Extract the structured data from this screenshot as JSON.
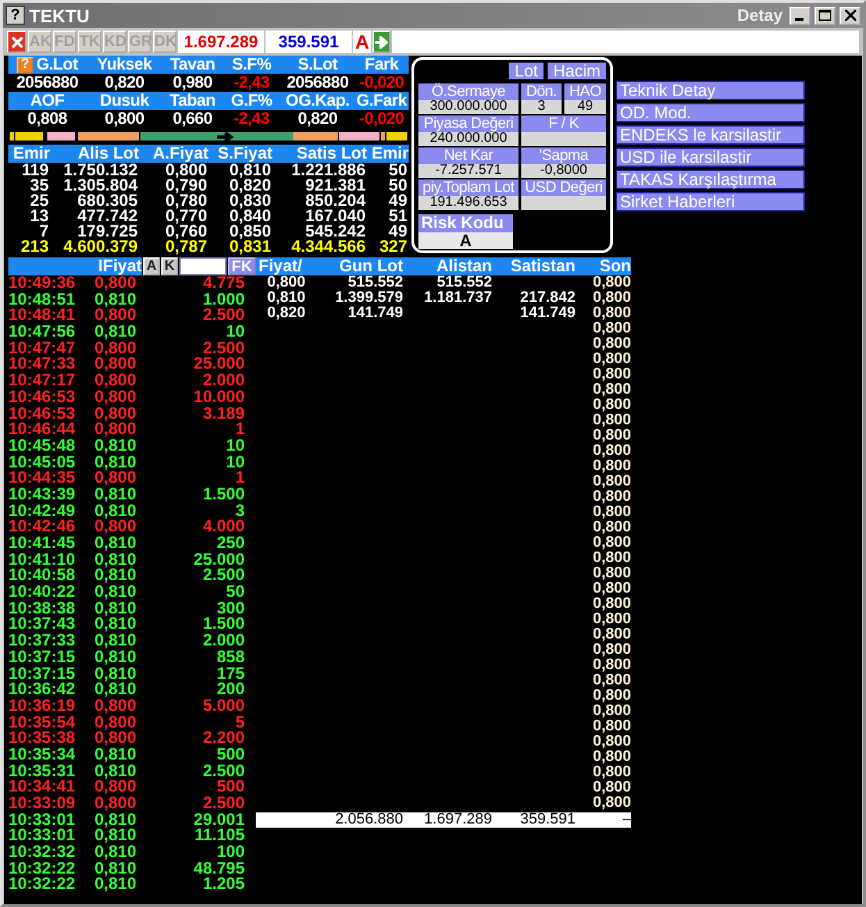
{
  "window": {
    "title_icon": "?",
    "title": "TEKTU",
    "subtitle": "Detay"
  },
  "toolbar": {
    "tabs": [
      {
        "label": "AK",
        "disabled": true
      },
      {
        "label": "FD",
        "disabled": true
      },
      {
        "label": "TK",
        "disabled": true
      },
      {
        "label": "KD",
        "disabled": true
      },
      {
        "label": "GR",
        "disabled": true
      },
      {
        "label": "DK",
        "disabled": true
      }
    ],
    "buy_total": "1.697.289",
    "sell_total": "359.591",
    "risk_flag": "A"
  },
  "stats": {
    "help": "?",
    "rows": [
      {
        "cells": [
          {
            "label": "G.Lot",
            "value": "2056880",
            "negative": false
          },
          {
            "label": "Yuksek",
            "value": "0,820",
            "negative": false
          },
          {
            "label": "Tavan",
            "value": "0,980",
            "negative": false
          },
          {
            "label": "S.F%",
            "value": "-2,43",
            "negative": true
          },
          {
            "label": "S.Lot",
            "value": "2056880",
            "negative": false
          },
          {
            "label": "Fark",
            "value": "-0,020",
            "negative": true
          }
        ]
      },
      {
        "cells": [
          {
            "label": "AOF",
            "value": "0,808",
            "negative": false
          },
          {
            "label": "Dusuk",
            "value": "0,800",
            "negative": false
          },
          {
            "label": "Taban",
            "value": "0,660",
            "negative": false
          },
          {
            "label": "G.F%",
            "value": "-2,43",
            "negative": true
          },
          {
            "label": "OG.Kap.",
            "value": "0,820",
            "negative": false
          },
          {
            "label": "G.Fark",
            "value": "-0,020",
            "negative": true
          }
        ]
      }
    ]
  },
  "order_book": {
    "columns": [
      "Emir",
      "Alis Lot",
      "A.Fiyat",
      "S.Fiyat",
      "Satis Lot",
      "Emir"
    ],
    "rows": [
      {
        "kind": "level",
        "cells": [
          "119",
          "1.750.132",
          "0,800",
          "0,810",
          "1.221.886",
          "50"
        ]
      },
      {
        "kind": "level",
        "cells": [
          "35",
          "1.305.804",
          "0,790",
          "0,820",
          "921.381",
          "50"
        ]
      },
      {
        "kind": "level",
        "cells": [
          "25",
          "680.305",
          "0,780",
          "0,830",
          "850.204",
          "49"
        ]
      },
      {
        "kind": "level",
        "cells": [
          "13",
          "477.742",
          "0,770",
          "0,840",
          "167.040",
          "51"
        ]
      },
      {
        "kind": "level",
        "cells": [
          "7",
          "179.725",
          "0,760",
          "0,850",
          "545.242",
          "49"
        ]
      },
      {
        "kind": "total",
        "cells": [
          "213",
          "4.600.379",
          "0,787",
          "0,831",
          "4.344.566",
          "327"
        ]
      }
    ]
  },
  "info_panel": {
    "toggles": [
      "Lot",
      "Hacim"
    ],
    "rows": [
      {
        "fields": [
          {
            "label": "Ö.Sermaye",
            "value": "300.000.000"
          },
          {
            "label": "Dön.",
            "value": "3"
          },
          {
            "label": "HAO",
            "value": "49"
          }
        ]
      },
      {
        "fields": [
          {
            "label": "Piyasa Değeri",
            "value": "240.000.000"
          },
          {
            "label": "F / K"
          }
        ]
      },
      {
        "fields": [
          {
            "label": "Net Kar",
            "value": "-7.257.571"
          },
          {
            "label": "'Sapma",
            "value": "-0,8000"
          }
        ]
      },
      {
        "fields": [
          {
            "label": "piy.Toplam Lot",
            "value": "191.496.653"
          },
          {
            "label": "USD Değeri"
          }
        ]
      }
    ],
    "risk": {
      "label": "Risk Kodu",
      "value": "A"
    }
  },
  "menu": [
    "Teknik Detay",
    "OD. Mod.",
    "ENDEKS le karsilastir",
    "USD ile karsilastir",
    "TAKAS Karşılaştırma",
    "Sirket Haberleri"
  ],
  "trades": {
    "header": "IFiyat",
    "buttons": [
      "A",
      "K"
    ],
    "filter": "FK",
    "rows": [
      {
        "time": "10:49:36",
        "price": "0,800",
        "lot": "4.775",
        "color": "#ff2020"
      },
      {
        "time": "10:48:51",
        "price": "0,810",
        "lot": "1.000",
        "color": "#33ff33"
      },
      {
        "time": "10:48:41",
        "price": "0,800",
        "lot": "2.500",
        "color": "#ff2020"
      },
      {
        "time": "10:47:56",
        "price": "0,810",
        "lot": "10",
        "color": "#33ff33"
      },
      {
        "time": "10:47:47",
        "price": "0,800",
        "lot": "2.500",
        "color": "#ff2020"
      },
      {
        "time": "10:47:33",
        "price": "0,800",
        "lot": "25.000",
        "color": "#ff2020"
      },
      {
        "time": "10:47:17",
        "price": "0,800",
        "lot": "2.000",
        "color": "#ff2020"
      },
      {
        "time": "10:46:53",
        "price": "0,800",
        "lot": "10.000",
        "color": "#ff2020"
      },
      {
        "time": "10:46:53",
        "price": "0,800",
        "lot": "3.189",
        "color": "#ff2020"
      },
      {
        "time": "10:46:44",
        "price": "0,800",
        "lot": "1",
        "color": "#ff2020"
      },
      {
        "time": "10:45:48",
        "price": "0,810",
        "lot": "10",
        "color": "#33ff33"
      },
      {
        "time": "10:45:05",
        "price": "0,810",
        "lot": "10",
        "color": "#33ff33"
      },
      {
        "time": "10:44:35",
        "price": "0,800",
        "lot": "1",
        "color": "#ff2020"
      },
      {
        "time": "10:43:39",
        "price": "0,810",
        "lot": "1.500",
        "color": "#33ff33"
      },
      {
        "time": "10:42:49",
        "price": "0,810",
        "lot": "3",
        "color": "#33ff33"
      },
      {
        "time": "10:42:46",
        "price": "0,800",
        "lot": "4.000",
        "color": "#ff2020"
      },
      {
        "time": "10:41:45",
        "price": "0,810",
        "lot": "250",
        "color": "#33ff33"
      },
      {
        "time": "10:41:10",
        "price": "0,810",
        "lot": "25.000",
        "color": "#33ff33"
      },
      {
        "time": "10:40:58",
        "price": "0,810",
        "lot": "2.500",
        "color": "#33ff33"
      },
      {
        "time": "10:40:22",
        "price": "0,810",
        "lot": "50",
        "color": "#33ff33"
      },
      {
        "time": "10:38:38",
        "price": "0,810",
        "lot": "300",
        "color": "#33ff33"
      },
      {
        "time": "10:37:43",
        "price": "0,810",
        "lot": "1.500",
        "color": "#33ff33"
      },
      {
        "time": "10:37:33",
        "price": "0,810",
        "lot": "2.000",
        "color": "#33ff33"
      },
      {
        "time": "10:37:15",
        "price": "0,810",
        "lot": "858",
        "color": "#33ff33"
      },
      {
        "time": "10:37:15",
        "price": "0,810",
        "lot": "175",
        "color": "#33ff33"
      },
      {
        "time": "10:36:42",
        "price": "0,810",
        "lot": "200",
        "color": "#33ff33"
      },
      {
        "time": "10:36:19",
        "price": "0,800",
        "lot": "5.000",
        "color": "#ff2020"
      },
      {
        "time": "10:35:54",
        "price": "0,800",
        "lot": "5",
        "color": "#ff2020"
      },
      {
        "time": "10:35:38",
        "price": "0,800",
        "lot": "2.200",
        "color": "#ff2020"
      },
      {
        "time": "10:35:34",
        "price": "0,810",
        "lot": "500",
        "color": "#33ff33"
      },
      {
        "time": "10:35:31",
        "price": "0,810",
        "lot": "2.500",
        "color": "#33ff33"
      },
      {
        "time": "10:34:41",
        "price": "0,800",
        "lot": "500",
        "color": "#ff2020"
      },
      {
        "time": "10:33:09",
        "price": "0,800",
        "lot": "2.500",
        "color": "#ff2020"
      },
      {
        "time": "10:33:01",
        "price": "0,810",
        "lot": "29.001",
        "color": "#33ff33"
      },
      {
        "time": "10:33:01",
        "price": "0,810",
        "lot": "11.105",
        "color": "#33ff33"
      },
      {
        "time": "10:32:32",
        "price": "0,810",
        "lot": "100",
        "color": "#33ff33"
      },
      {
        "time": "10:32:22",
        "price": "0,810",
        "lot": "48.795",
        "color": "#33ff33"
      },
      {
        "time": "10:32:22",
        "price": "0,810",
        "lot": "1.205",
        "color": "#33ff33"
      }
    ]
  },
  "price_table": {
    "columns": [
      "Fiyat/",
      "Gun Lot",
      "Alistan",
      "Satistan",
      "Son"
    ],
    "rows": [
      {
        "price": "0,800",
        "gun_lot": "515.552",
        "alistan": "515.552",
        "son": "0,800"
      },
      {
        "price": "0,810",
        "gun_lot": "1.399.579",
        "alistan": "1.181.737",
        "satistan": "217.842",
        "son": "0,800"
      },
      {
        "price": "0,820",
        "gun_lot": "141.749",
        "satistan": "141.749",
        "son": "0,800"
      },
      {
        "son": "0,800"
      },
      {
        "son": "0,800"
      },
      {
        "son": "0,800"
      },
      {
        "son": "0,800"
      },
      {
        "son": "0,800"
      },
      {
        "son": "0,800"
      },
      {
        "son": "0,800"
      },
      {
        "son": "0,800"
      },
      {
        "son": "0,800"
      },
      {
        "son": "0,800"
      },
      {
        "son": "0,800"
      },
      {
        "son": "0,800"
      },
      {
        "son": "0,800"
      },
      {
        "son": "0,800"
      },
      {
        "son": "0,800"
      },
      {
        "son": "0,800"
      },
      {
        "son": "0,800"
      },
      {
        "son": "0,800"
      },
      {
        "son": "0,800"
      },
      {
        "son": "0,800"
      },
      {
        "son": "0,800"
      },
      {
        "son": "0,800"
      },
      {
        "son": "0,800"
      },
      {
        "son": "0,800"
      },
      {
        "son": "0,800"
      },
      {
        "son": "0,800"
      },
      {
        "son": "0,800"
      },
      {
        "son": "0,800"
      },
      {
        "son": "0,800"
      },
      {
        "son": "0,800"
      },
      {
        "son": "0,800"
      },
      {
        "son": "0,800"
      }
    ],
    "totals": [
      "2.056.880",
      "1.697.289",
      "359.591",
      "–"
    ]
  }
}
